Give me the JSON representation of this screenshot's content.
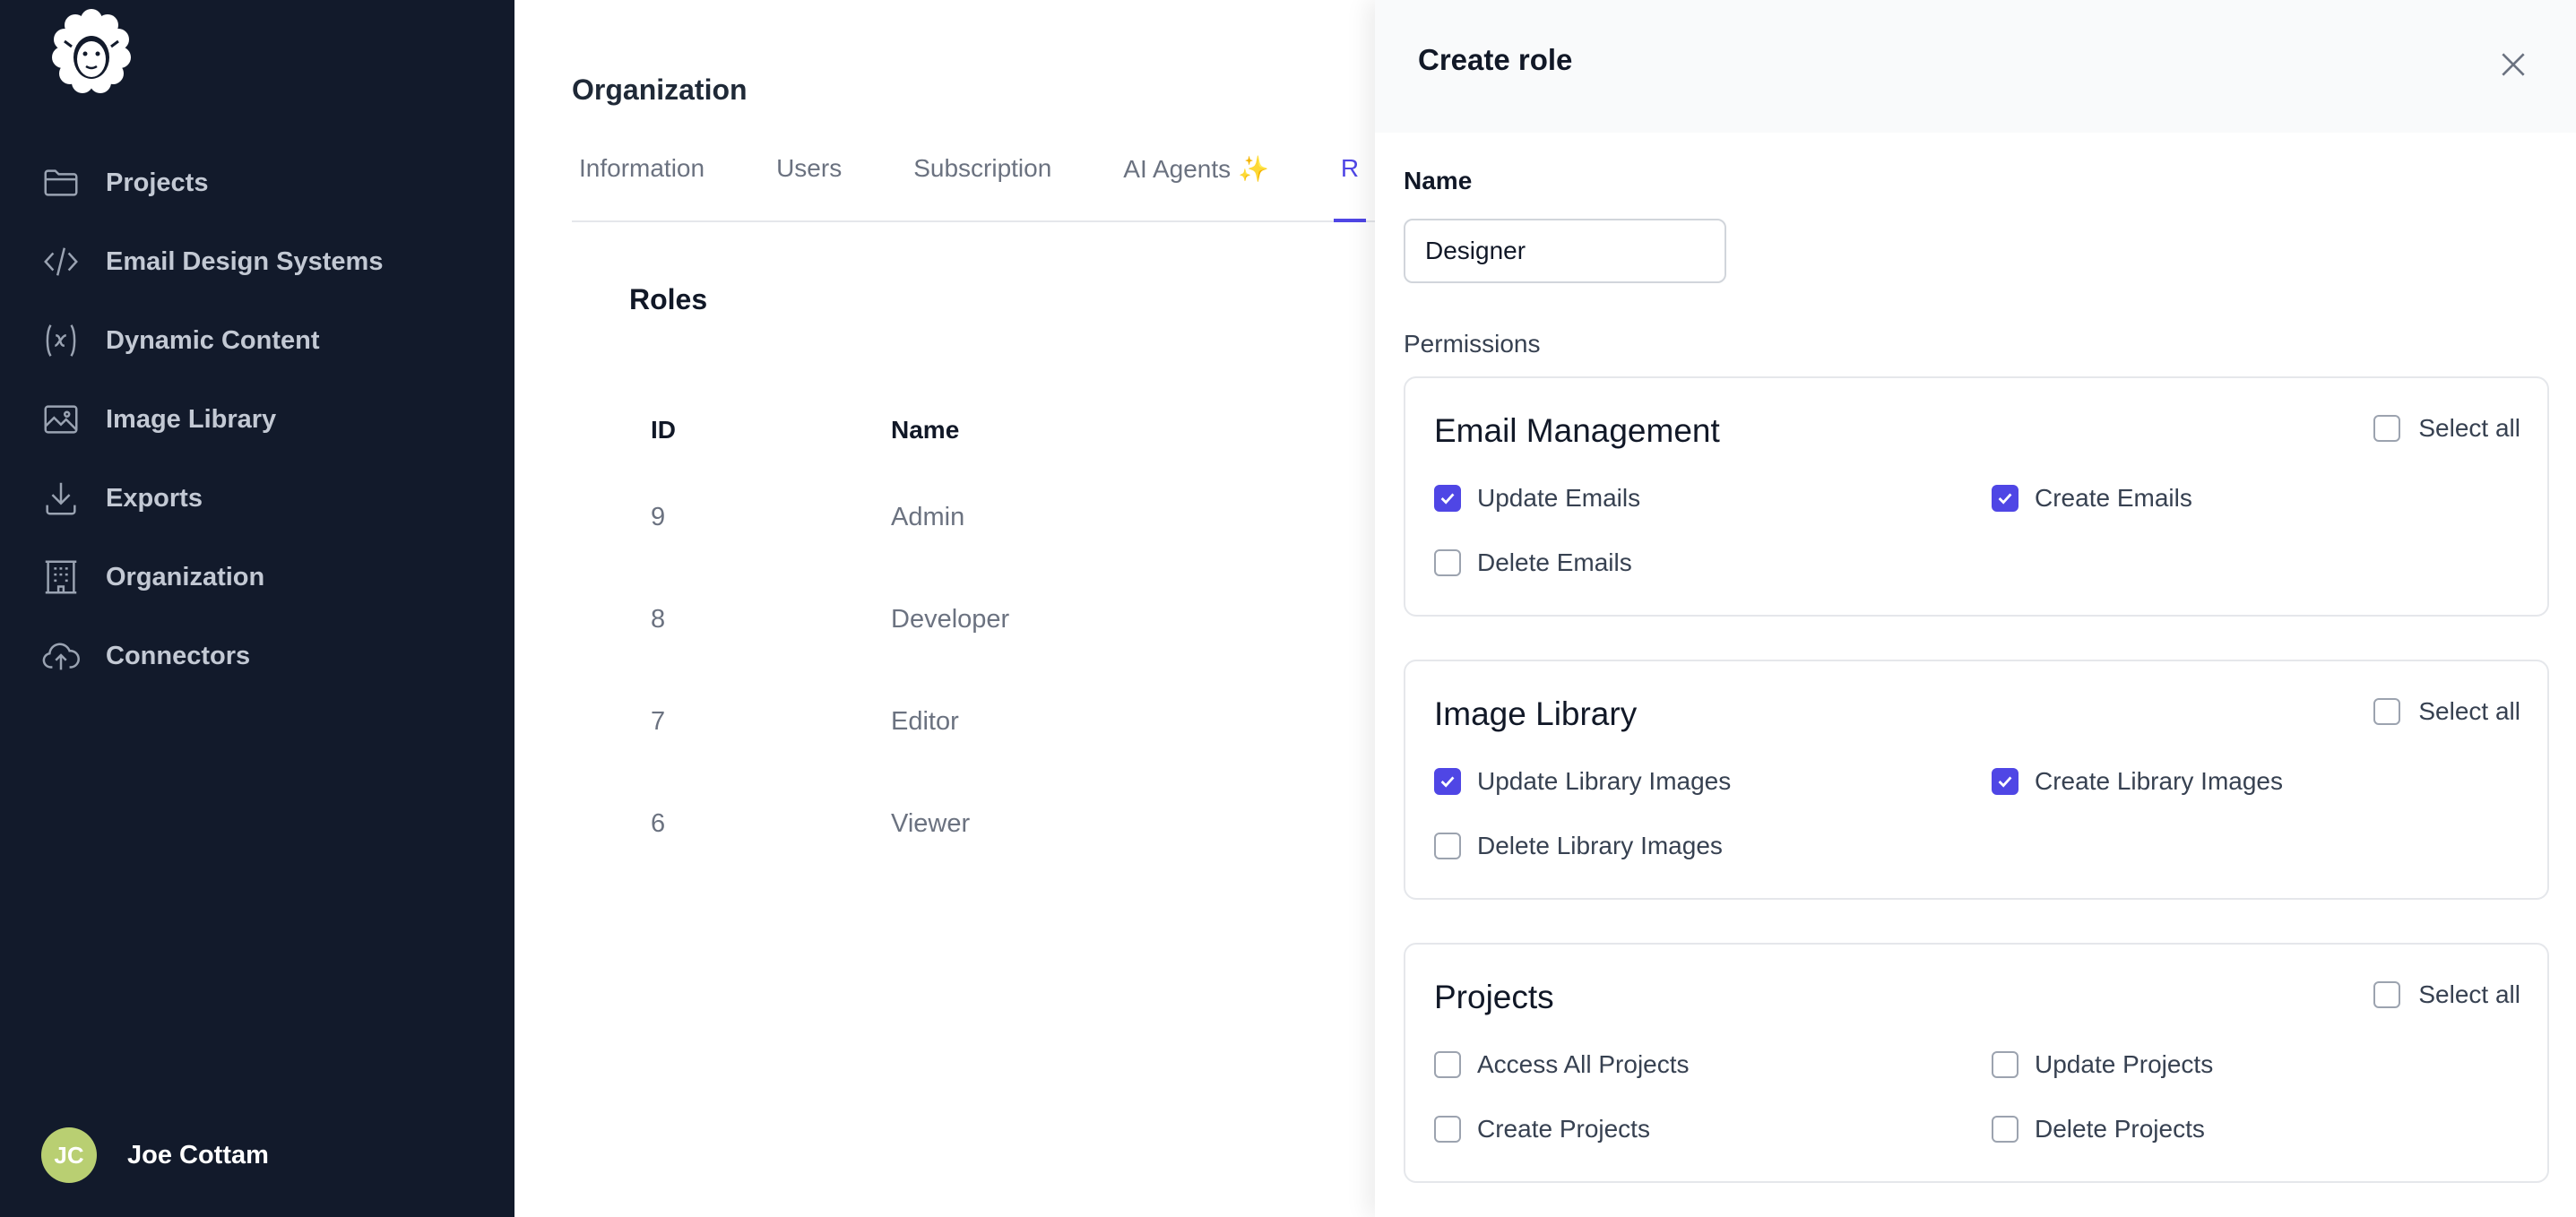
{
  "sidebar": {
    "items": [
      {
        "label": "Projects",
        "icon": "folder-icon"
      },
      {
        "label": "Email Design Systems",
        "icon": "code-icon"
      },
      {
        "label": "Dynamic Content",
        "icon": "variable-icon"
      },
      {
        "label": "Image Library",
        "icon": "image-icon"
      },
      {
        "label": "Exports",
        "icon": "download-icon"
      },
      {
        "label": "Organization",
        "icon": "building-icon"
      },
      {
        "label": "Connectors",
        "icon": "cloud-upload-icon"
      }
    ],
    "user": {
      "initials": "JC",
      "name": "Joe Cottam",
      "avatar_color": "#b9cf72"
    }
  },
  "main": {
    "title": "Organization",
    "tabs": [
      {
        "label": "Information",
        "active": false
      },
      {
        "label": "Users",
        "active": false
      },
      {
        "label": "Subscription",
        "active": false
      },
      {
        "label": "AI Agents ✨",
        "active": false
      },
      {
        "label": "R",
        "active": true
      }
    ],
    "roles": {
      "title": "Roles",
      "columns": [
        "ID",
        "Name"
      ],
      "rows": [
        {
          "id": "9",
          "name": "Admin"
        },
        {
          "id": "8",
          "name": "Developer"
        },
        {
          "id": "7",
          "name": "Editor"
        },
        {
          "id": "6",
          "name": "Viewer"
        }
      ]
    }
  },
  "panel": {
    "title": "Create role",
    "name_label": "Name",
    "name_value": "Designer",
    "permissions_label": "Permissions",
    "groups": [
      {
        "title": "Email Management",
        "select_all": "Select all",
        "items": [
          {
            "label": "Update Emails",
            "checked": true
          },
          {
            "label": "Create Emails",
            "checked": true
          },
          {
            "label": "Delete Emails",
            "checked": false
          }
        ]
      },
      {
        "title": "Image Library",
        "select_all": "Select all",
        "items": [
          {
            "label": "Update Library Images",
            "checked": true
          },
          {
            "label": "Create Library Images",
            "checked": true
          },
          {
            "label": "Delete Library Images",
            "checked": false
          }
        ]
      },
      {
        "title": "Projects",
        "select_all": "Select all",
        "items": [
          {
            "label": "Access All Projects",
            "checked": false
          },
          {
            "label": "Update Projects",
            "checked": false
          },
          {
            "label": "Create Projects",
            "checked": false
          },
          {
            "label": "Delete Projects",
            "checked": false
          }
        ]
      }
    ]
  },
  "colors": {
    "sidebar_bg": "#121a2b",
    "accent": "#4f46e5",
    "panel_header_bg": "#f9fafb"
  }
}
